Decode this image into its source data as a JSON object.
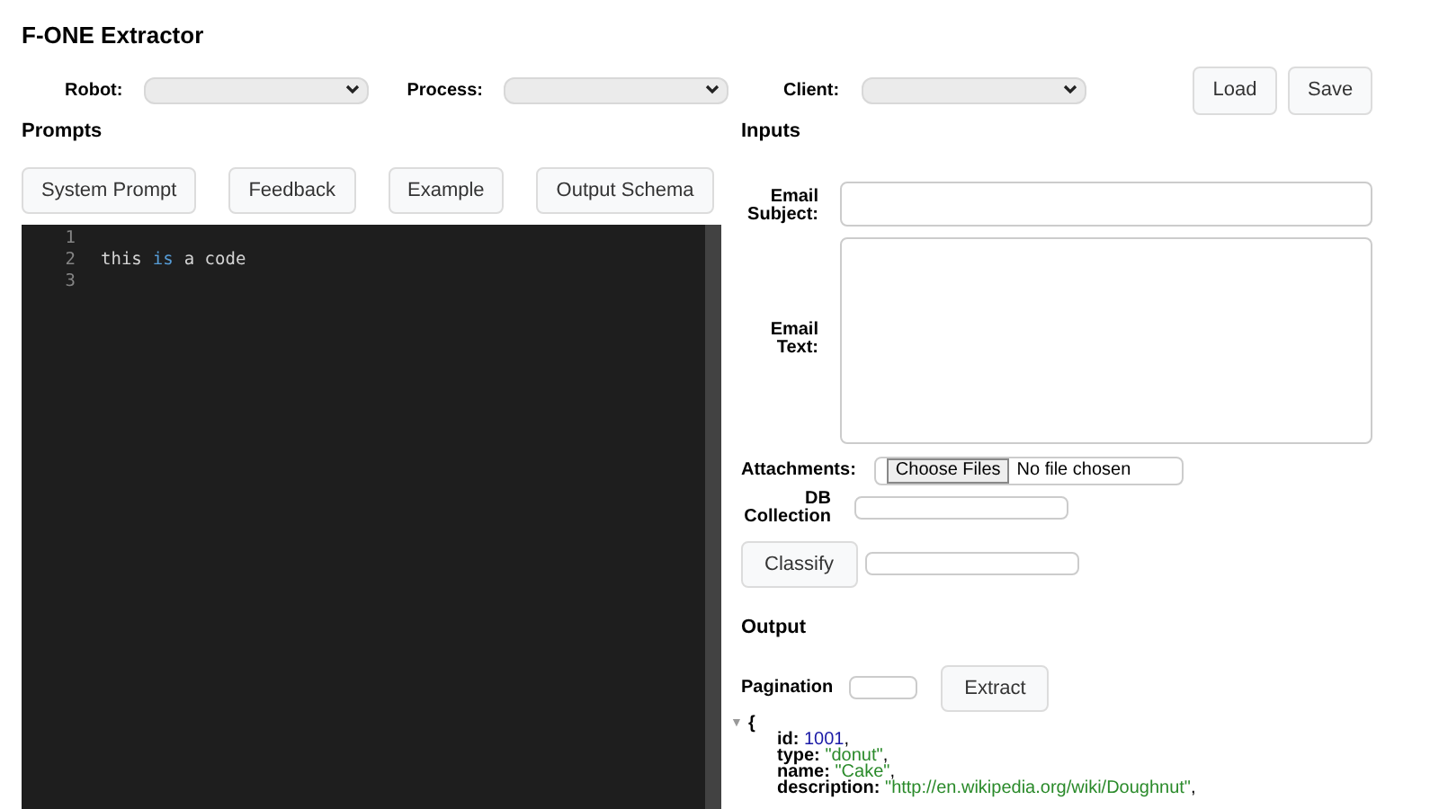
{
  "title": "F-ONE Extractor",
  "selectors": [
    {
      "label": "Robot:"
    },
    {
      "label": "Process:"
    },
    {
      "label": "Client:"
    }
  ],
  "top_buttons": [
    "Load",
    "Save"
  ],
  "prompts": {
    "heading": "Prompts",
    "tabs": [
      "System Prompt",
      "Feedback",
      "Example",
      "Output Schema"
    ],
    "editor": {
      "lines": [
        {
          "number": "1"
        },
        {
          "number": "2",
          "tokens": [
            {
              "text": "this",
              "kind": "plain"
            },
            {
              "text": "is",
              "kind": "keyword"
            },
            {
              "text": "a code",
              "kind": "plain"
            }
          ]
        },
        {
          "number": "3"
        }
      ]
    }
  },
  "inputs": {
    "heading": "Inputs",
    "email_subject_label": "Email Subject:",
    "email_text_label": "Email Text:",
    "attachments_label": "Attachments:",
    "choose_files": "Choose Files",
    "no_file": "No file chosen",
    "db_label": "DB Collection",
    "classify": "Classify"
  },
  "output": {
    "heading": "Output",
    "pagination_label": "Pagination",
    "extract": "Extract",
    "toggle": "▼",
    "open_brace": "{",
    "fields": [
      {
        "key": "id:",
        "value": "1001",
        "kind": "number",
        "trail": ","
      },
      {
        "key": "type:",
        "value": "\"donut\"",
        "kind": "string",
        "trail": ","
      },
      {
        "key": "name:",
        "value": "\"Cake\"",
        "kind": "string",
        "trail": ","
      },
      {
        "key": "description:",
        "value": "\"http://en.wikipedia.org/wiki/Doughnut\"",
        "kind": "string",
        "trail": ","
      }
    ]
  }
}
